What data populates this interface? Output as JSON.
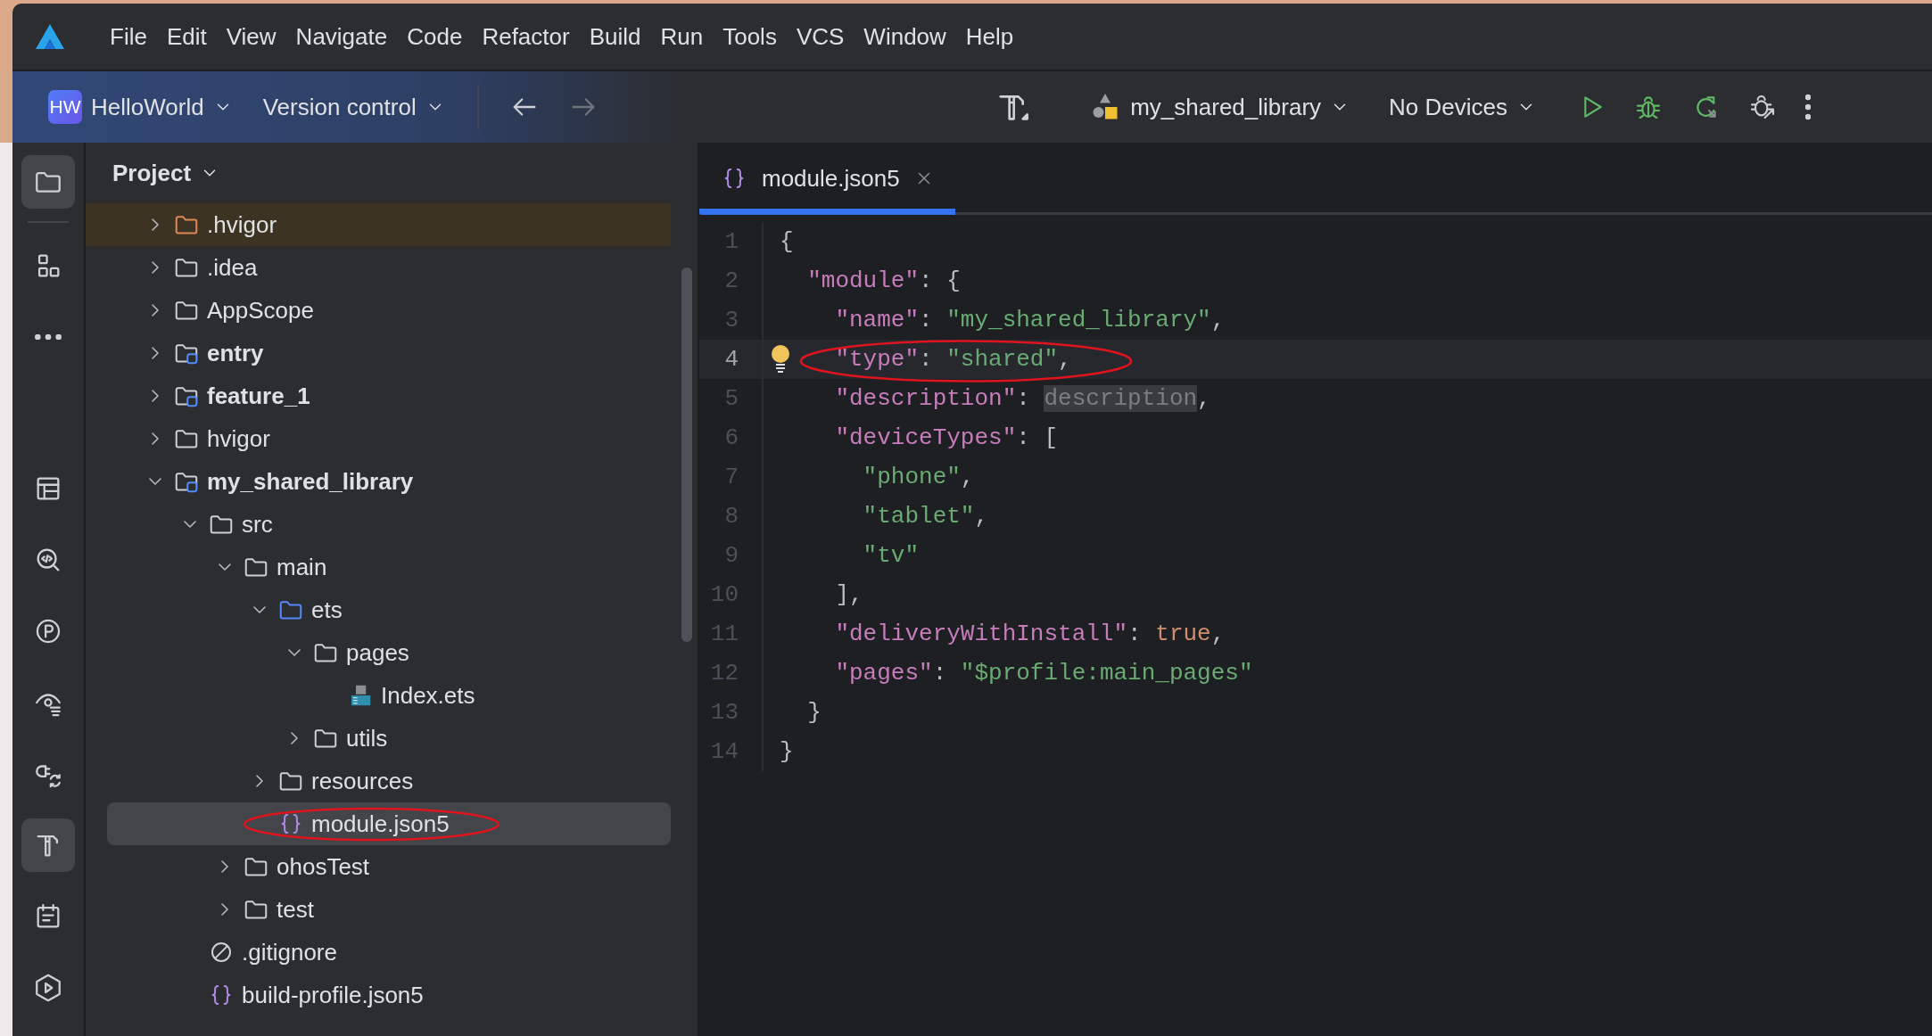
{
  "menu_bar": {
    "items": [
      "File",
      "Edit",
      "View",
      "Navigate",
      "Code",
      "Refactor",
      "Build",
      "Run",
      "Tools",
      "VCS",
      "Window",
      "Help"
    ]
  },
  "toolbar": {
    "project_badge": "HW",
    "project": "HelloWorld",
    "version_control": "Version control",
    "navigation": [
      {
        "kind": "back",
        "disabled": false
      },
      {
        "kind": "forward",
        "disabled": true
      }
    ],
    "module": "my_shared_library",
    "device": "No Devices",
    "actions": [
      {
        "kind": "run"
      },
      {
        "kind": "debug"
      },
      {
        "kind": "apply"
      },
      {
        "kind": "attach"
      },
      {
        "kind": "more"
      }
    ]
  },
  "tool_strip": {
    "top": [
      {
        "kind": "project",
        "selected": true
      },
      {
        "kind": "structure",
        "selected": false
      },
      {
        "kind": "more",
        "selected": false
      }
    ],
    "bottom": [
      {
        "kind": "table",
        "selected": false
      },
      {
        "kind": "code-search",
        "selected": false
      },
      {
        "kind": "profiler",
        "selected": false
      },
      {
        "kind": "preview",
        "selected": false
      },
      {
        "kind": "sync",
        "selected": false
      },
      {
        "kind": "build",
        "selected": true
      },
      {
        "kind": "notes",
        "selected": false
      },
      {
        "kind": "run-panel",
        "selected": false
      }
    ]
  },
  "project_panel": {
    "title": "Project",
    "tree": [
      {
        "name": ".hvigor",
        "kind": "excluded-folder",
        "expanded": false,
        "selected": false,
        "circled": false
      },
      {
        "name": ".idea",
        "kind": "folder",
        "expanded": false,
        "selected": false,
        "circled": false
      },
      {
        "name": "AppScope",
        "kind": "folder",
        "expanded": false,
        "selected": false,
        "circled": false
      },
      {
        "name": "entry",
        "kind": "module",
        "expanded": false,
        "selected": false,
        "circled": false
      },
      {
        "name": "feature_1",
        "kind": "module",
        "expanded": false,
        "selected": false,
        "circled": false
      },
      {
        "name": "hvigor",
        "kind": "folder",
        "expanded": false,
        "selected": false,
        "circled": false
      },
      {
        "name": "my_shared_library",
        "kind": "module",
        "expanded": true,
        "selected": false,
        "circled": false,
        "children": [
          {
            "name": "src",
            "kind": "folder",
            "expanded": true,
            "selected": false,
            "circled": false,
            "children": [
              {
                "name": "main",
                "kind": "folder",
                "expanded": true,
                "selected": false,
                "circled": false,
                "children": [
                  {
                    "name": "ets",
                    "kind": "source-folder",
                    "expanded": true,
                    "selected": false,
                    "circled": false,
                    "children": [
                      {
                        "name": "pages",
                        "kind": "folder",
                        "expanded": true,
                        "selected": false,
                        "circled": false,
                        "children": [
                          {
                            "name": "Index.ets",
                            "kind": "ets-file",
                            "selected": false,
                            "circled": false
                          }
                        ]
                      },
                      {
                        "name": "utils",
                        "kind": "folder",
                        "expanded": false,
                        "selected": false,
                        "circled": false
                      }
                    ]
                  },
                  {
                    "name": "resources",
                    "kind": "folder",
                    "expanded": false,
                    "selected": false,
                    "circled": false
                  },
                  {
                    "name": "module.json5",
                    "kind": "json-file",
                    "selected": true,
                    "circled": true
                  }
                ]
              },
              {
                "name": "ohosTest",
                "kind": "folder",
                "expanded": false,
                "selected": false,
                "circled": false
              },
              {
                "name": "test",
                "kind": "folder",
                "expanded": false,
                "selected": false,
                "circled": false
              }
            ]
          },
          {
            "name": ".gitignore",
            "kind": "ignore-file",
            "selected": false,
            "circled": false
          },
          {
            "name": "build-profile.json5",
            "kind": "json-file",
            "selected": false,
            "circled": false
          }
        ]
      }
    ]
  },
  "editor": {
    "tabs": [
      {
        "label": "module.json5",
        "selected": true
      }
    ],
    "lines": [
      {
        "number": "1",
        "current": false,
        "bulb": false,
        "circled": false,
        "tokens": [
          {
            "kind": "punct",
            "text": "{"
          }
        ]
      },
      {
        "number": "2",
        "current": false,
        "bulb": false,
        "circled": false,
        "tokens": [
          {
            "kind": "key",
            "text": "  \"module\""
          },
          {
            "kind": "punct",
            "text": ": {"
          }
        ]
      },
      {
        "number": "3",
        "current": false,
        "bulb": false,
        "circled": false,
        "tokens": [
          {
            "kind": "key",
            "text": "    \"name\""
          },
          {
            "kind": "punct",
            "text": ": "
          },
          {
            "kind": "string",
            "text": "\"my_shared_library\""
          },
          {
            "kind": "punct",
            "text": ","
          }
        ]
      },
      {
        "number": "4",
        "current": true,
        "bulb": true,
        "circled": true,
        "tokens": [
          {
            "kind": "key",
            "text": "    \"type\""
          },
          {
            "kind": "punct",
            "text": ": "
          },
          {
            "kind": "string",
            "text": "\"shared\""
          },
          {
            "kind": "punct",
            "text": ","
          }
        ]
      },
      {
        "number": "5",
        "current": false,
        "bulb": false,
        "circled": false,
        "tokens": [
          {
            "kind": "key",
            "text": "    \"description\""
          },
          {
            "kind": "punct",
            "text": ": "
          },
          {
            "kind": "hint",
            "text": "description"
          },
          {
            "kind": "punct",
            "text": ","
          }
        ]
      },
      {
        "number": "6",
        "current": false,
        "bulb": false,
        "circled": false,
        "tokens": [
          {
            "kind": "key",
            "text": "    \"deviceTypes\""
          },
          {
            "kind": "punct",
            "text": ": ["
          }
        ]
      },
      {
        "number": "7",
        "current": false,
        "bulb": false,
        "circled": false,
        "tokens": [
          {
            "kind": "string",
            "text": "      \"phone\""
          },
          {
            "kind": "punct",
            "text": ","
          }
        ]
      },
      {
        "number": "8",
        "current": false,
        "bulb": false,
        "circled": false,
        "tokens": [
          {
            "kind": "string",
            "text": "      \"tablet\""
          },
          {
            "kind": "punct",
            "text": ","
          }
        ]
      },
      {
        "number": "9",
        "current": false,
        "bulb": false,
        "circled": false,
        "tokens": [
          {
            "kind": "string",
            "text": "      \"tv\""
          }
        ]
      },
      {
        "number": "10",
        "current": false,
        "bulb": false,
        "circled": false,
        "tokens": [
          {
            "kind": "punct",
            "text": "    ],"
          }
        ]
      },
      {
        "number": "11",
        "current": false,
        "bulb": false,
        "circled": false,
        "tokens": [
          {
            "kind": "key",
            "text": "    \"deliveryWithInstall\""
          },
          {
            "kind": "punct",
            "text": ": "
          },
          {
            "kind": "literal",
            "text": "true"
          },
          {
            "kind": "punct",
            "text": ","
          }
        ]
      },
      {
        "number": "12",
        "current": false,
        "bulb": false,
        "circled": false,
        "tokens": [
          {
            "kind": "key",
            "text": "    \"pages\""
          },
          {
            "kind": "punct",
            "text": ": "
          },
          {
            "kind": "string",
            "text": "\"$profile:main_pages\""
          }
        ]
      },
      {
        "number": "13",
        "current": false,
        "bulb": false,
        "circled": false,
        "tokens": [
          {
            "kind": "punct",
            "text": "  }"
          }
        ]
      },
      {
        "number": "14",
        "current": false,
        "bulb": false,
        "circled": false,
        "tokens": [
          {
            "kind": "punct",
            "text": "}"
          }
        ]
      }
    ]
  }
}
